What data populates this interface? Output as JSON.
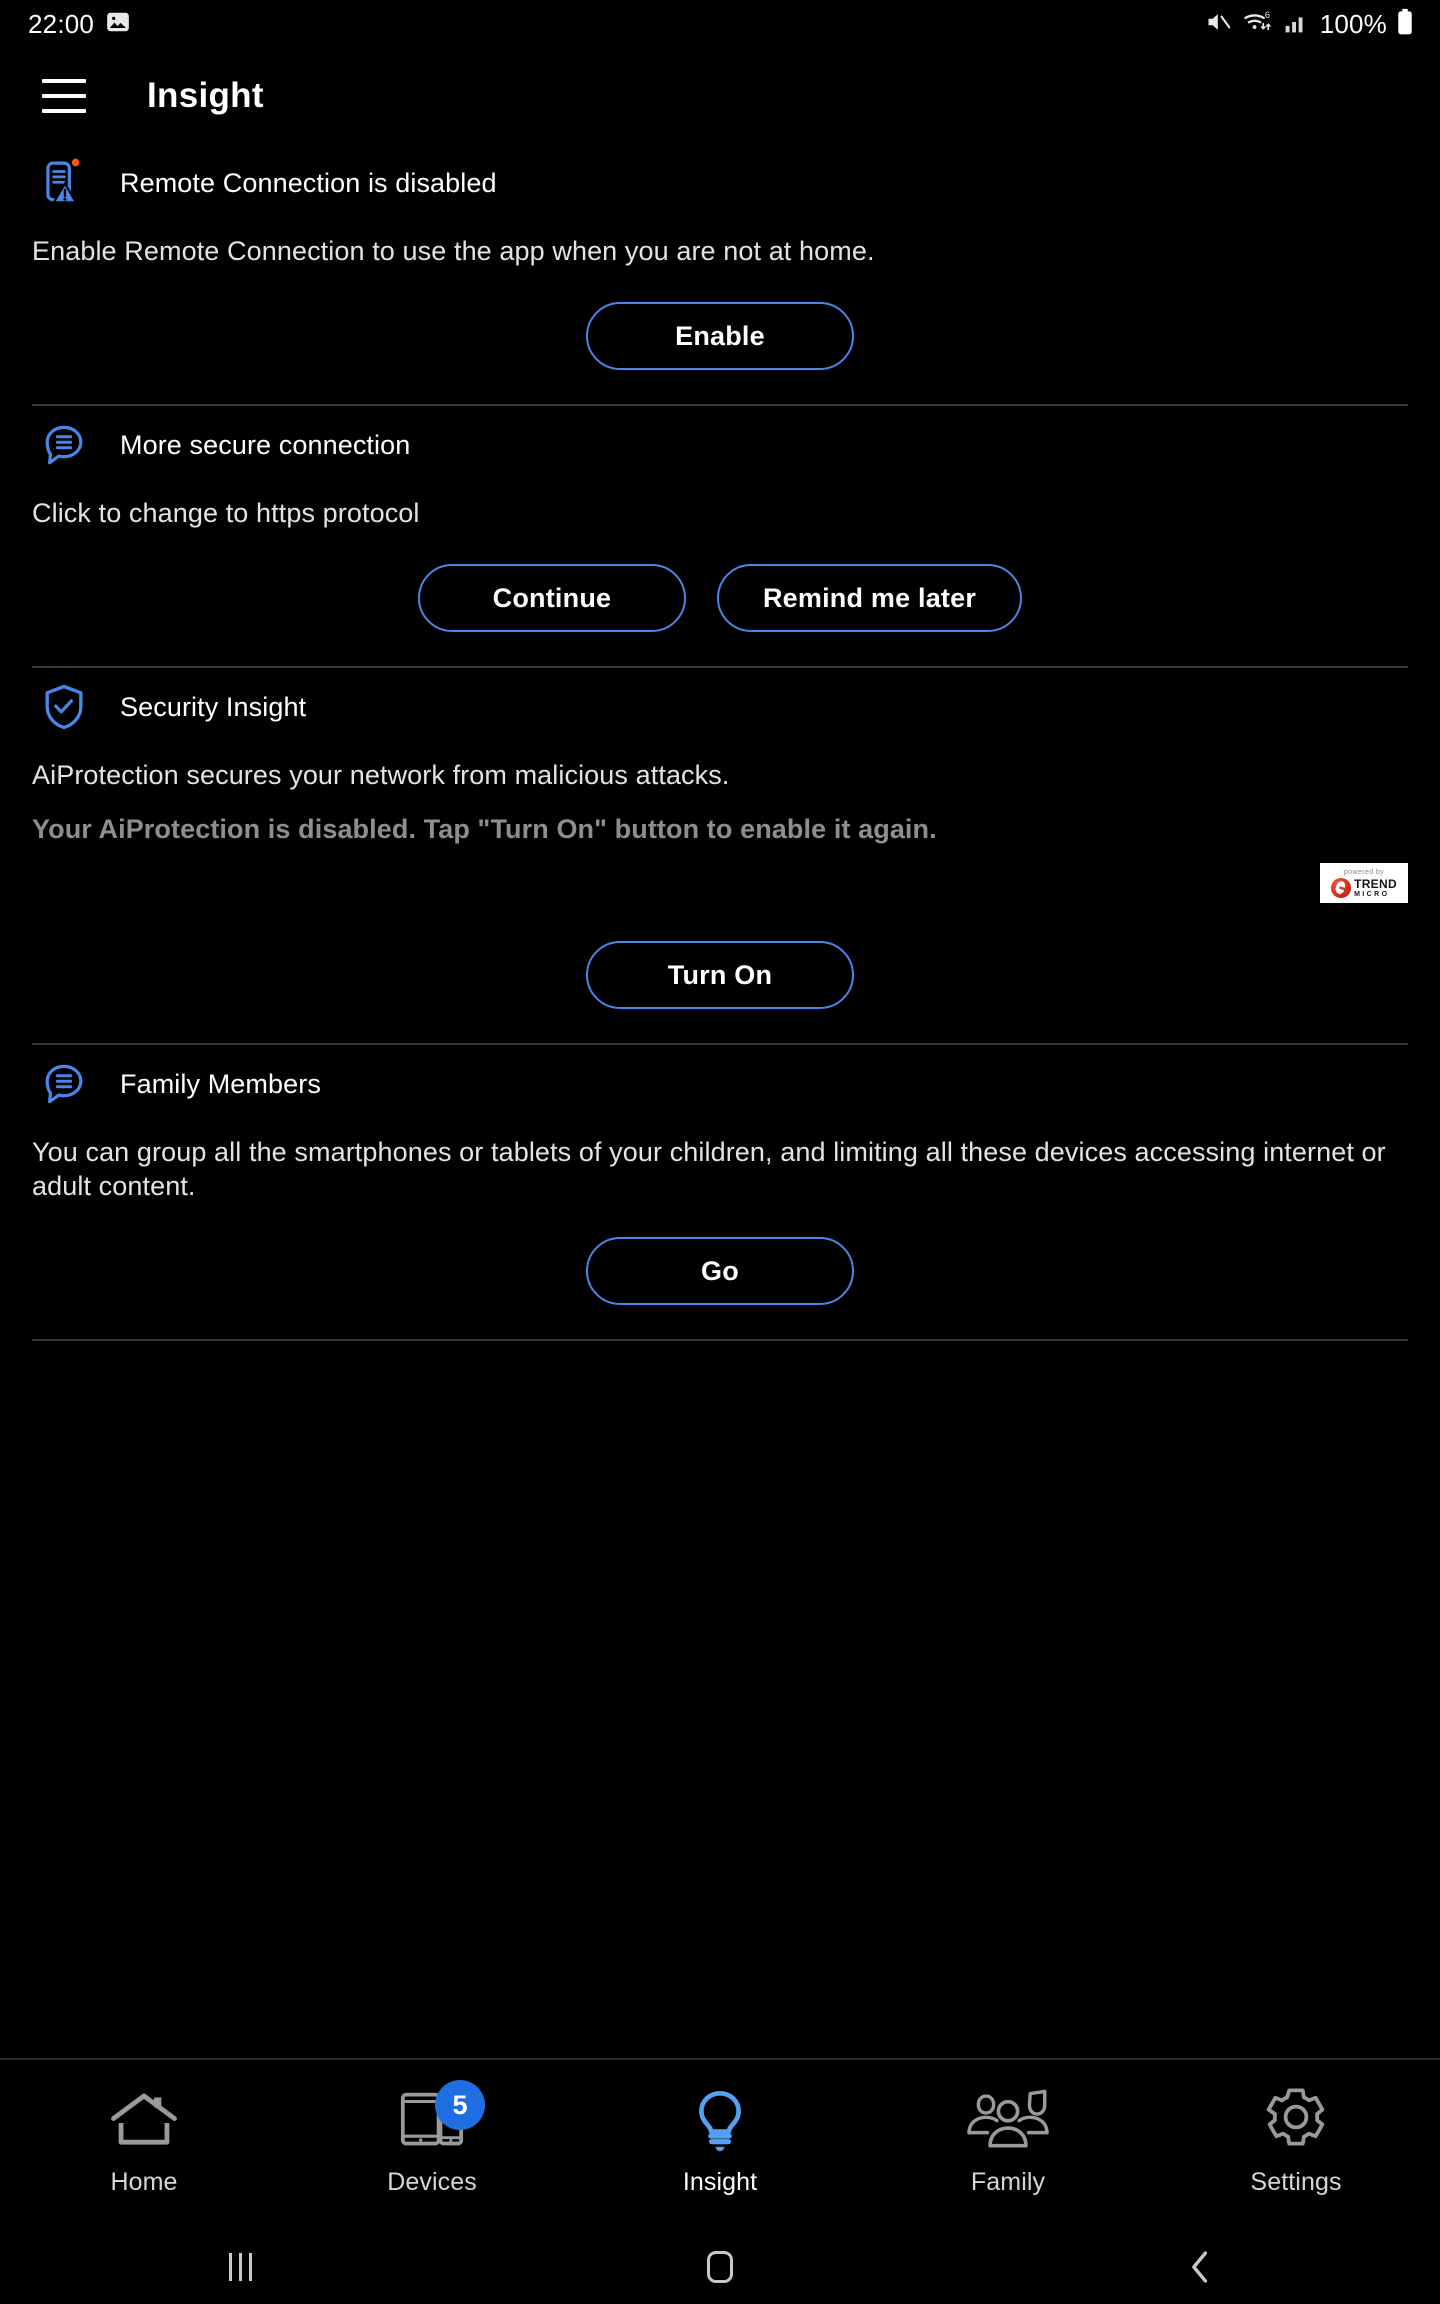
{
  "statusbar": {
    "time": "22:00",
    "gallery_icon": "image-icon",
    "mute_icon": "volume-mute-icon",
    "wifi_icon": "wifi-6-icon",
    "signal_icon": "cellular-signal-icon",
    "battery_percent": "100%",
    "battery_icon": "battery-full-icon"
  },
  "appbar": {
    "menu_icon": "hamburger-menu-icon",
    "title": "Insight"
  },
  "colors": {
    "accent_blue": "#4a86e8",
    "icon_blue": "#4a86e8",
    "badge_blue": "#1f6fe0",
    "alert_dot": "#f4511e",
    "background": "#000000",
    "divider": "#363636",
    "muted_text": "#8e8e8e"
  },
  "cards": [
    {
      "icon": "router-alert-icon",
      "title": "Remote Connection is disabled",
      "description": "Enable Remote Connection to use the app when you are not at home.",
      "buttons": [
        {
          "label": "Enable"
        }
      ]
    },
    {
      "icon": "speech-bubble-icon",
      "title": "More secure connection",
      "description": "Click to change to https protocol",
      "buttons": [
        {
          "label": "Continue"
        },
        {
          "label": "Remind me later"
        }
      ]
    },
    {
      "icon": "shield-check-icon",
      "title": "Security Insight",
      "description": "AiProtection secures your network from malicious attacks.",
      "warning": "Your AiProtection is disabled. Tap \"Turn On\" button to enable it again.",
      "badge": {
        "powered_by": "powered by",
        "brand_top": "TREND",
        "brand_bottom": "MICRO"
      },
      "buttons": [
        {
          "label": "Turn On"
        }
      ]
    },
    {
      "icon": "speech-bubble-icon",
      "title": "Family Members",
      "description": "You can group all the smartphones or tablets of your children, and limiting all these devices accessing internet or adult content.",
      "buttons": [
        {
          "label": "Go"
        }
      ]
    }
  ],
  "bottomnav": {
    "items": [
      {
        "label": "Home",
        "icon": "home-icon",
        "active": false,
        "badge": null
      },
      {
        "label": "Devices",
        "icon": "devices-icon",
        "active": false,
        "badge": "5"
      },
      {
        "label": "Insight",
        "icon": "lightbulb-icon",
        "active": true,
        "badge": null
      },
      {
        "label": "Family",
        "icon": "people-group-icon",
        "active": false,
        "badge": null
      },
      {
        "label": "Settings",
        "icon": "gear-icon",
        "active": false,
        "badge": null
      }
    ]
  },
  "sysbar": {
    "recents_icon": "recents-icon",
    "home_icon": "home-square-icon",
    "back_icon": "back-chevron-icon"
  }
}
